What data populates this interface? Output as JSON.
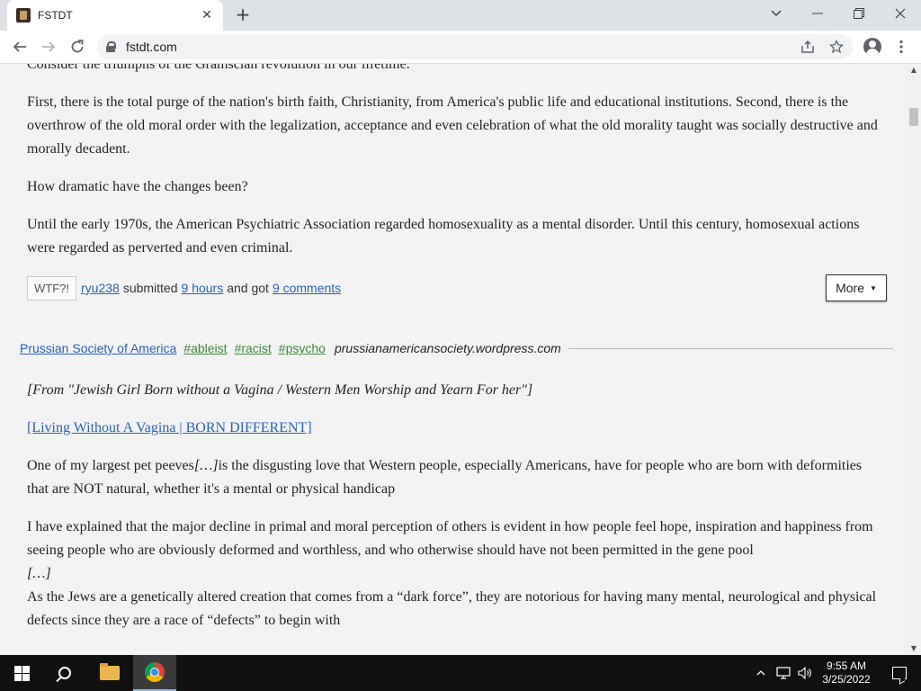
{
  "browser": {
    "tab_title": "FSTDT",
    "url": "fstdt.com",
    "new_tab_glyph": "+",
    "tab_close_glyph": "✕"
  },
  "post1": {
    "cut_line": "Consider the triumphs of the Gramscian revolution in our lifetime.",
    "paragraphs": [
      "First, there is the total purge of the nation's birth faith, Christianity, from America's public life and educational institutions. Second, there is the overthrow of the old moral order with the legalization, acceptance and even celebration of what the old morality taught was socially destructive and morally decadent.",
      "How dramatic have the changes been?",
      "Until the early 1970s, the American Psychiatric Association regarded homosexuality as a mental disorder. Until this century, homosexual actions were regarded as perverted and even criminal."
    ],
    "meta": {
      "wtf_label": "WTF?!",
      "user": "ryu238",
      "submitted_text": "submitted",
      "time": "9 hours",
      "and_got_text": "and got",
      "comments": "9 comments",
      "more_label": "More",
      "more_caret": "▼"
    }
  },
  "post2": {
    "source": "Prussian Society of America",
    "tags": [
      "#ableist",
      "#racist",
      "#psycho"
    ],
    "domain": "prussianamericansociety.wordpress.com",
    "quote_head": "[From \"Jewish Girl Born without a Vagina / Western Men Worship and Yearn For her\"]",
    "video_link": "[Living Without A Vagina | BORN DIFFERENT]",
    "p1_before": "One of my largest pet peeves",
    "p1_ellipsis": "[…]",
    "p1_after": "is the disgusting love that Western people, especially Americans, have for people who are born with deformities that are NOT natural, whether it's a mental or physical handicap",
    "p2": "I have explained that the major decline in primal and moral perception of others is evident in how people feel hope, inspiration and happiness from seeing people who are obviously deformed and worthless, and who otherwise should have not been permitted in the gene pool",
    "p2_ellipsis": "[…]",
    "p3": "As the Jews are a genetically altered creation that comes from a “dark force”, they are notorious for having many mental, neurological and physical defects since they are a race of “defects” to begin with"
  },
  "taskbar": {
    "time": "9:55 AM",
    "date": "3/25/2022"
  },
  "colors": {
    "link": "#2b62b4",
    "tag": "#3c8a3c",
    "page_bg": "#f3f3f3",
    "tabstrip_bg": "#dee1e6",
    "taskbar_bg": "#101010"
  }
}
